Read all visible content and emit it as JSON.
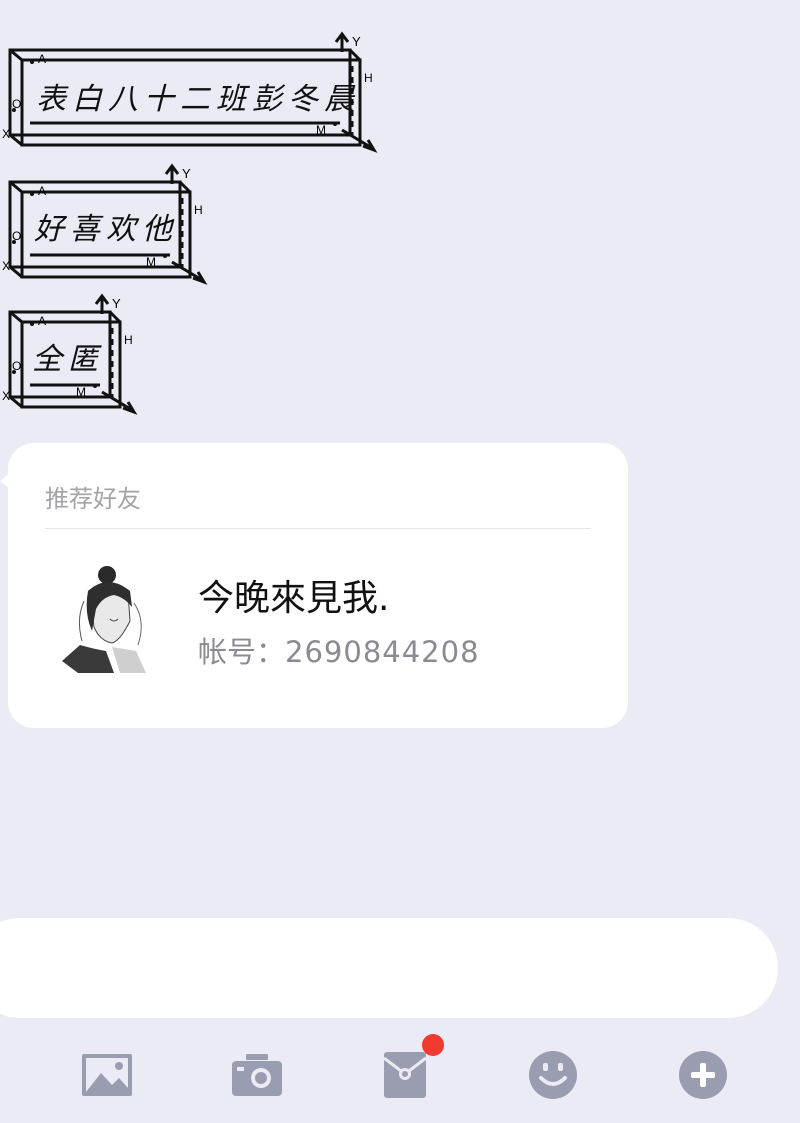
{
  "stickers": [
    {
      "text": "表白八十二班彭冬晨"
    },
    {
      "text": "好喜欢他"
    },
    {
      "text": "全匿"
    }
  ],
  "sticker_axis_labels": {
    "a": "A",
    "o": "O",
    "x": "X",
    "y": "Y",
    "h": "H",
    "m": "M"
  },
  "contact_card": {
    "header": "推荐好友",
    "name": "今晚來見我.",
    "account_label": "帐号：",
    "account_number": "2690844208"
  },
  "toolbar": {
    "icons": [
      "image-icon",
      "camera-icon",
      "red-packet-icon",
      "emoji-icon",
      "plus-icon"
    ],
    "red_packet_badge": true
  },
  "colors": {
    "background": "#ebebf5",
    "card": "#ffffff",
    "icon": "#9a9cb0",
    "badge": "#f23b30"
  }
}
